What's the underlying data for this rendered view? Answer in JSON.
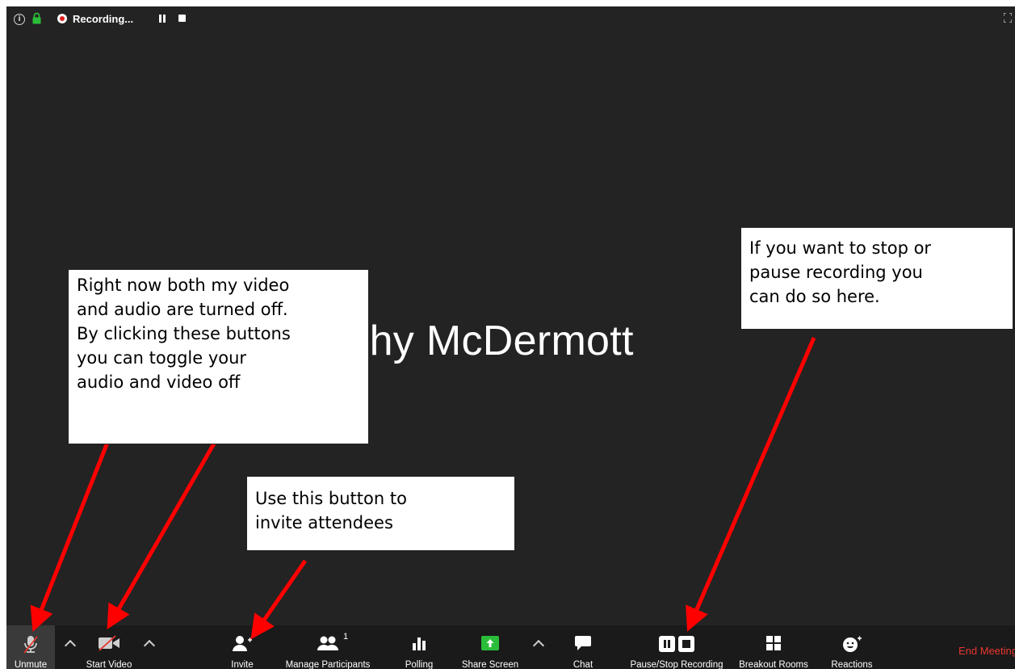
{
  "window": {
    "recording_status": "Recording...",
    "participant_name": "Timothy McDermott"
  },
  "toolbar": {
    "unmute": "Unmute",
    "start_video": "Start Video",
    "invite": "Invite",
    "manage_participants": "Manage Participants",
    "participant_count": "1",
    "polling": "Polling",
    "share_screen": "Share Screen",
    "chat": "Chat",
    "pause_stop_recording": "Pause/Stop Recording",
    "breakout_rooms": "Breakout Rooms",
    "reactions": "Reactions",
    "end_meeting": "End Meeting"
  },
  "annotations": {
    "audio_video_note": [
      "Right now both my video",
      "and audio are turned off.",
      "By clicking these buttons",
      "you can toggle your",
      "audio and video off"
    ],
    "invite_note": [
      "Use this button to",
      "invite attendees"
    ],
    "recording_note": [
      "If you want to stop or",
      "pause recording you",
      "can do so here."
    ]
  },
  "colors": {
    "background": "#232323",
    "toolbar": "#1a1a1a",
    "recording_red": "#e0211c",
    "end_meeting_red": "#e8372f",
    "share_green": "#2bbd3a",
    "arrow_red": "#ff0000"
  },
  "icons": [
    "info-icon",
    "lock-icon",
    "record-icon",
    "pause-icon",
    "stop-icon",
    "fullscreen-icon",
    "mic-muted-icon",
    "video-off-icon",
    "invite-icon",
    "participants-icon",
    "polling-icon",
    "share-screen-icon",
    "chat-icon",
    "recording-controls-icon",
    "breakout-rooms-icon",
    "reactions-icon"
  ]
}
